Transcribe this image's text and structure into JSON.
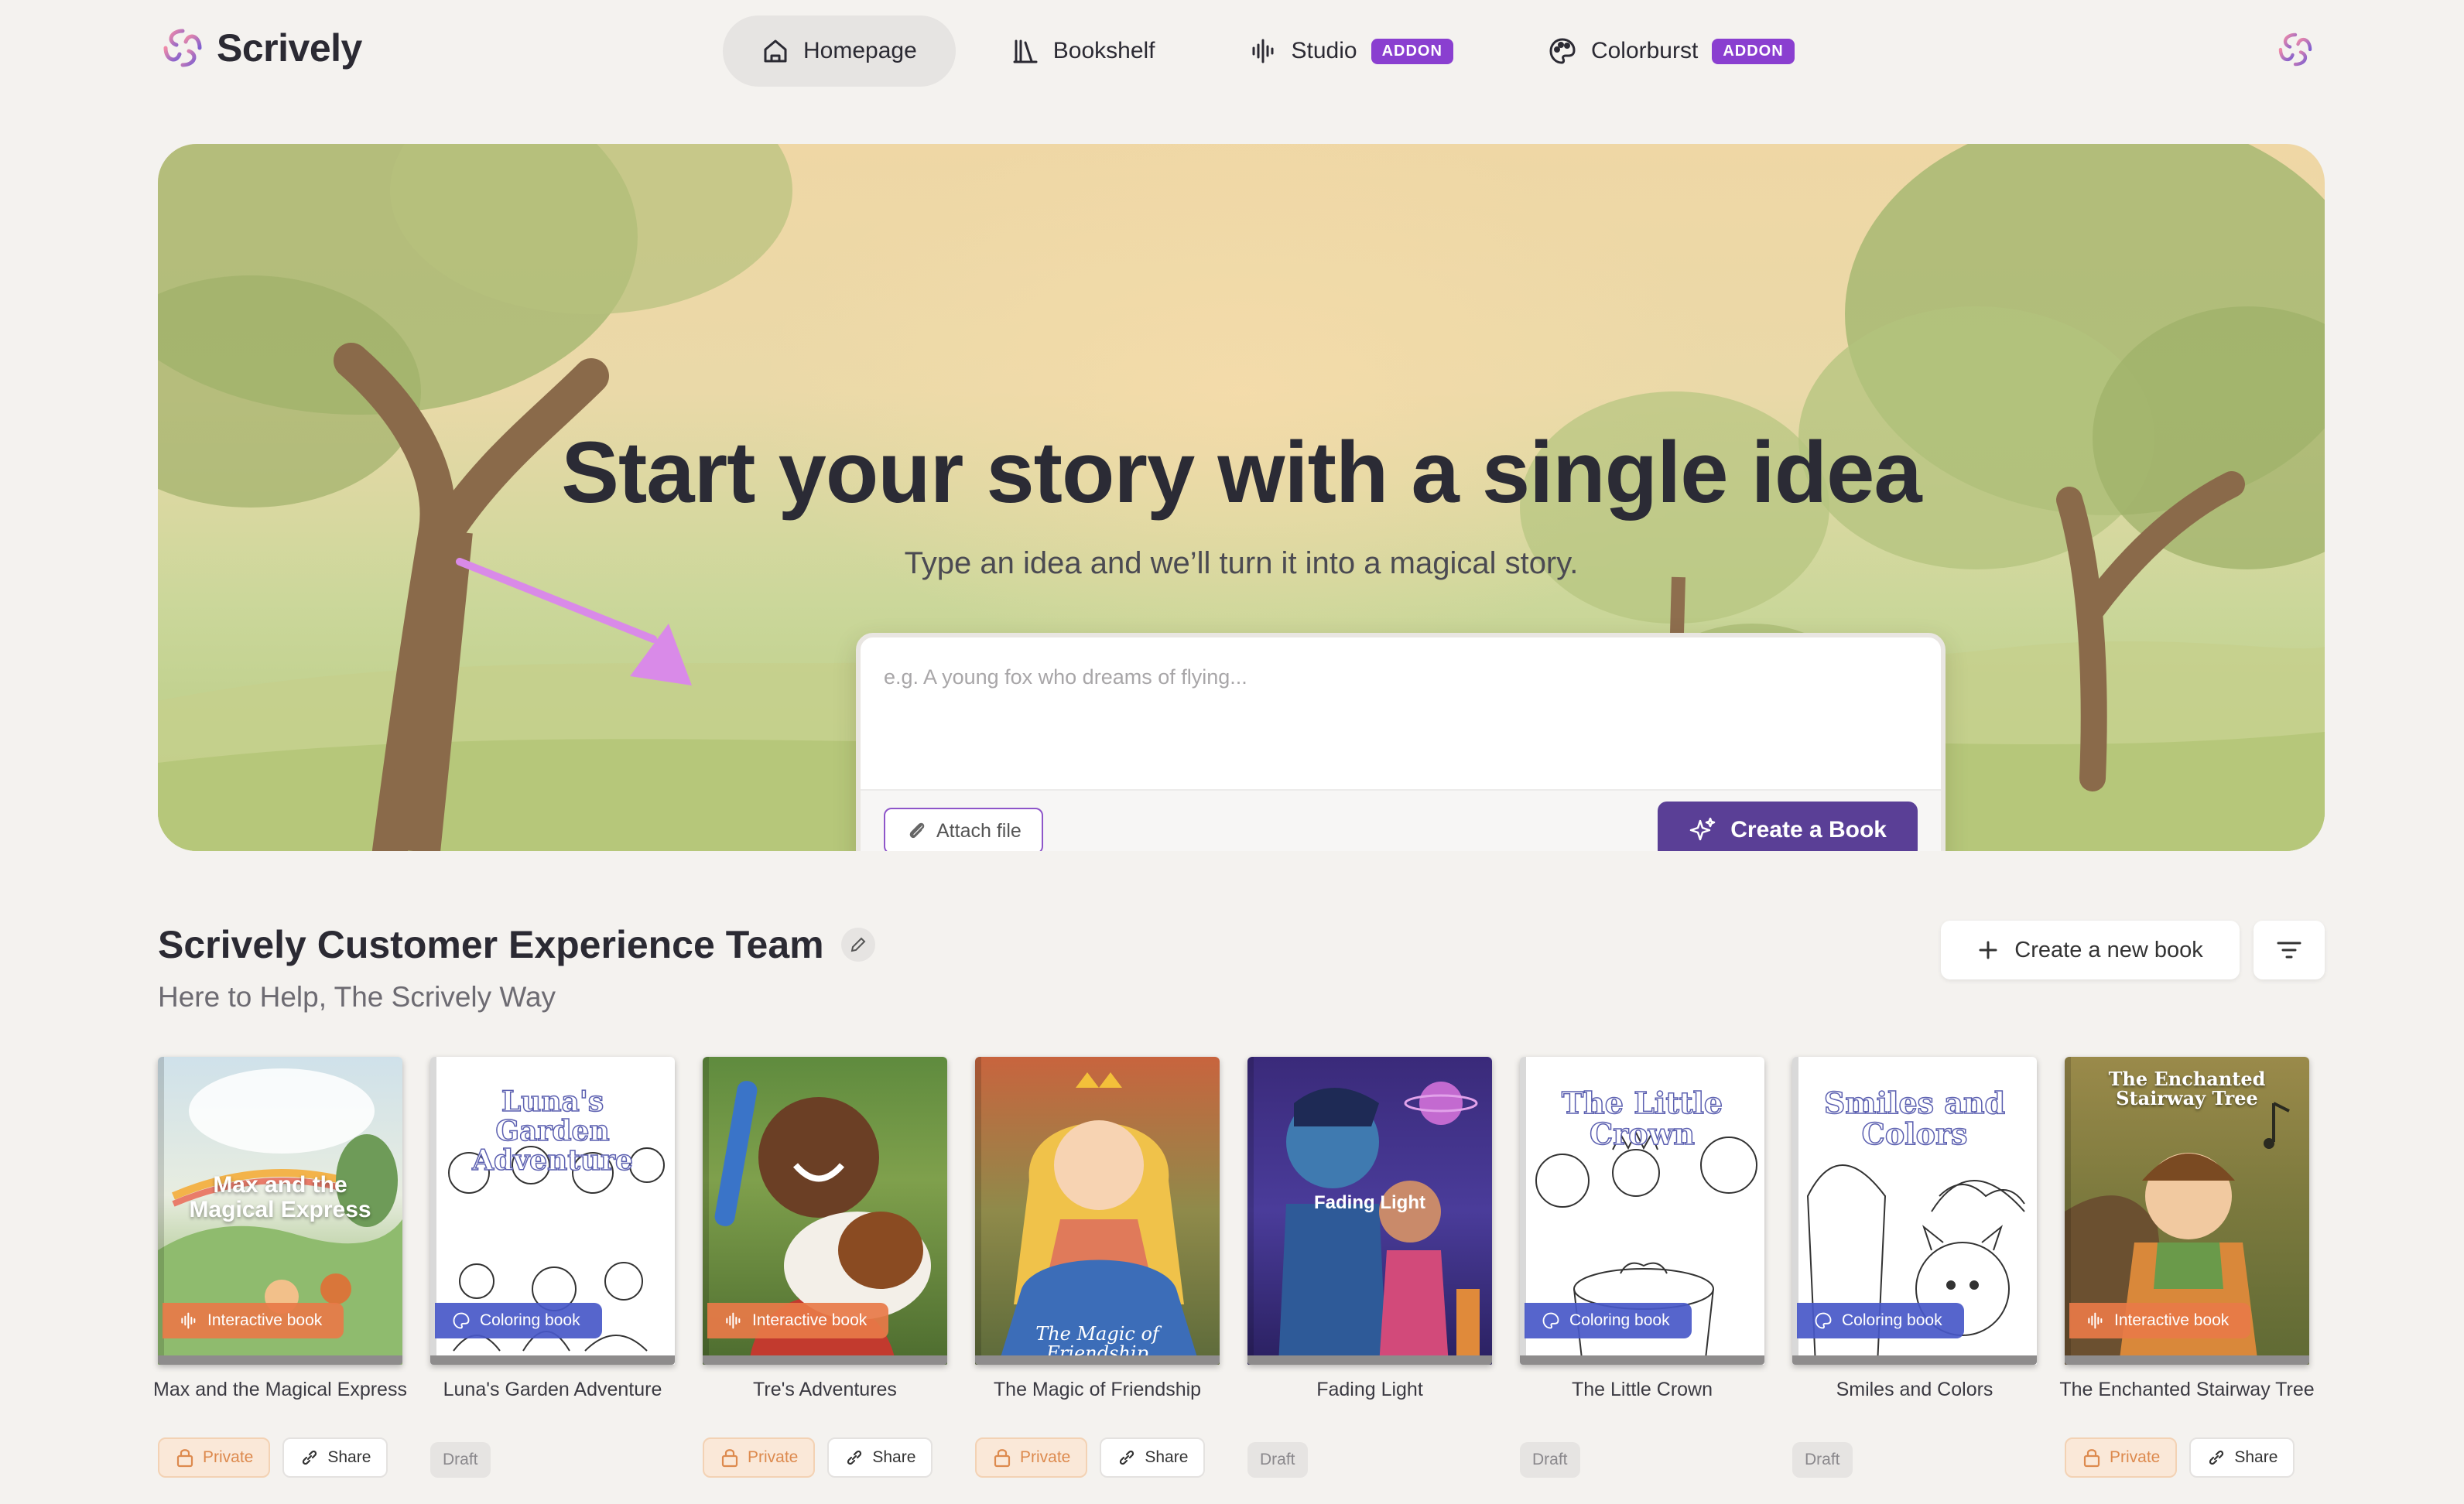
{
  "app": {
    "name": "Scrively",
    "brand_color": "#7e5fd0",
    "accent_color": "#5a3f96"
  },
  "nav": {
    "items": [
      {
        "label": "Homepage",
        "icon": "home-icon",
        "active": true
      },
      {
        "label": "Bookshelf",
        "icon": "books-icon"
      },
      {
        "label": "Studio",
        "icon": "audio-wave-icon",
        "badge": "ADDON"
      },
      {
        "label": "Colorburst",
        "icon": "palette-icon",
        "badge": "ADDON"
      }
    ]
  },
  "hero": {
    "title": "Start your story with a single idea",
    "subtitle": "Type an idea and we’ll turn it into a magical story.",
    "placeholder": "e.g. A young fox who dreams of flying...",
    "attach_label": "Attach file",
    "create_label": "Create a Book"
  },
  "team": {
    "title": "Scrively Customer Experience Team",
    "subtitle": "Here to Help, The Scrively Way",
    "new_book_label": "Create a new book"
  },
  "books": [
    {
      "title": "Max and the Magical Express",
      "cover_text": "Max and the Magical Express",
      "type": "Interactive book",
      "status": "Private",
      "share": "Share"
    },
    {
      "title": "Luna's Garden Adventure",
      "cover_text": "Luna's Garden Adventure",
      "type": "Coloring book",
      "status": "Draft"
    },
    {
      "title": "Tre's Adventures",
      "cover_text": "",
      "type": "Interactive book",
      "status": "Private",
      "share": "Share"
    },
    {
      "title": "The Magic of Friendship",
      "cover_text": "The Magic of Friendship",
      "type": "",
      "status": "Private",
      "share": "Share"
    },
    {
      "title": "Fading Light",
      "cover_text": "Fading Light",
      "type": "",
      "status": "Draft"
    },
    {
      "title": "The Little Crown",
      "cover_text": "The Little Crown",
      "type": "Coloring book",
      "status": "Draft"
    },
    {
      "title": "Smiles and Colors",
      "cover_text": "Smiles and Colors",
      "type": "Coloring book",
      "status": "Draft"
    },
    {
      "title": "The Enchanted Stairway Tree",
      "cover_text": "The Enchanted Stairway Tree",
      "type": "Interactive book",
      "status": "Private",
      "share": "Share"
    }
  ]
}
